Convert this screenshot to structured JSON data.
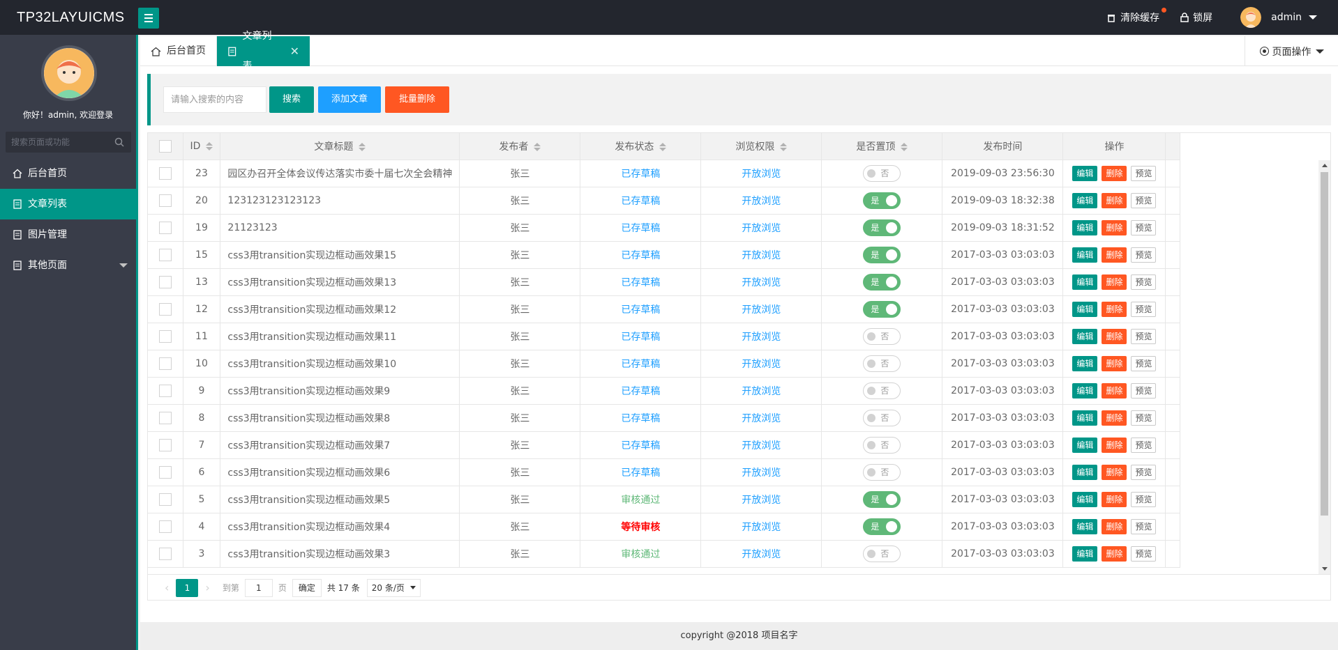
{
  "header": {
    "brand": "TP32LAYUICMS",
    "clear_cache": "清除缓存",
    "lock_screen": "锁屏",
    "user": "admin"
  },
  "sidebar": {
    "welcome": "你好！admin, 欢迎登录",
    "search_placeholder": "搜索页面或功能",
    "items": [
      {
        "label": "后台首页",
        "icon": "home-icon"
      },
      {
        "label": "文章列表",
        "icon": "article-icon",
        "active": true
      },
      {
        "label": "图片管理",
        "icon": "image-icon"
      },
      {
        "label": "其他页面",
        "icon": "page-icon",
        "expandable": true
      }
    ]
  },
  "tabs": {
    "home": "后台首页",
    "article": "文章列表",
    "page_ops": "页面操作"
  },
  "toolbar": {
    "search_placeholder": "请输入搜索的内容",
    "search_btn": "搜索",
    "add_btn": "添加文章",
    "batch_delete_btn": "批量删除"
  },
  "table": {
    "columns": [
      "ID",
      "文章标题",
      "发布者",
      "发布状态",
      "浏览权限",
      "是否置顶",
      "发布时间",
      "操作"
    ],
    "actions": {
      "edit": "编辑",
      "delete": "删除",
      "preview": "预览"
    },
    "switch": {
      "on": "是",
      "off": "否"
    },
    "rows": [
      {
        "id": "23",
        "title": "园区办召开全体会议传达落实市委十届七次全会精神",
        "author": "张三",
        "status": "已存草稿",
        "status_type": "draft",
        "perm": "开放浏览",
        "top": false,
        "time": "2019-09-03 23:56:30"
      },
      {
        "id": "20",
        "title": "123123123123123",
        "author": "张三",
        "status": "已存草稿",
        "status_type": "draft",
        "perm": "开放浏览",
        "top": true,
        "time": "2019-09-03 18:32:38"
      },
      {
        "id": "19",
        "title": "21123123",
        "author": "张三",
        "status": "已存草稿",
        "status_type": "draft",
        "perm": "开放浏览",
        "top": true,
        "time": "2019-09-03 18:31:52"
      },
      {
        "id": "15",
        "title": "css3用transition实现边框动画效果15",
        "author": "张三",
        "status": "已存草稿",
        "status_type": "draft",
        "perm": "开放浏览",
        "top": true,
        "time": "2017-03-03 03:03:03"
      },
      {
        "id": "13",
        "title": "css3用transition实现边框动画效果13",
        "author": "张三",
        "status": "已存草稿",
        "status_type": "draft",
        "perm": "开放浏览",
        "top": true,
        "time": "2017-03-03 03:03:03"
      },
      {
        "id": "12",
        "title": "css3用transition实现边框动画效果12",
        "author": "张三",
        "status": "已存草稿",
        "status_type": "draft",
        "perm": "开放浏览",
        "top": true,
        "time": "2017-03-03 03:03:03"
      },
      {
        "id": "11",
        "title": "css3用transition实现边框动画效果11",
        "author": "张三",
        "status": "已存草稿",
        "status_type": "draft",
        "perm": "开放浏览",
        "top": false,
        "time": "2017-03-03 03:03:03"
      },
      {
        "id": "10",
        "title": "css3用transition实现边框动画效果10",
        "author": "张三",
        "status": "已存草稿",
        "status_type": "draft",
        "perm": "开放浏览",
        "top": false,
        "time": "2017-03-03 03:03:03"
      },
      {
        "id": "9",
        "title": "css3用transition实现边框动画效果9",
        "author": "张三",
        "status": "已存草稿",
        "status_type": "draft",
        "perm": "开放浏览",
        "top": false,
        "time": "2017-03-03 03:03:03"
      },
      {
        "id": "8",
        "title": "css3用transition实现边框动画效果8",
        "author": "张三",
        "status": "已存草稿",
        "status_type": "draft",
        "perm": "开放浏览",
        "top": false,
        "time": "2017-03-03 03:03:03"
      },
      {
        "id": "7",
        "title": "css3用transition实现边框动画效果7",
        "author": "张三",
        "status": "已存草稿",
        "status_type": "draft",
        "perm": "开放浏览",
        "top": false,
        "time": "2017-03-03 03:03:03"
      },
      {
        "id": "6",
        "title": "css3用transition实现边框动画效果6",
        "author": "张三",
        "status": "已存草稿",
        "status_type": "draft",
        "perm": "开放浏览",
        "top": false,
        "time": "2017-03-03 03:03:03"
      },
      {
        "id": "5",
        "title": "css3用transition实现边框动画效果5",
        "author": "张三",
        "status": "审核通过",
        "status_type": "pass",
        "perm": "开放浏览",
        "top": true,
        "time": "2017-03-03 03:03:03"
      },
      {
        "id": "4",
        "title": "css3用transition实现边框动画效果4",
        "author": "张三",
        "status": "等待审核",
        "status_type": "wait",
        "perm": "开放浏览",
        "top": true,
        "time": "2017-03-03 03:03:03"
      },
      {
        "id": "3",
        "title": "css3用transition实现边框动画效果3",
        "author": "张三",
        "status": "审核通过",
        "status_type": "pass",
        "perm": "开放浏览",
        "top": false,
        "time": "2017-03-03 03:03:03"
      }
    ]
  },
  "pager": {
    "current": "1",
    "goto_label": "到第",
    "goto_value": "1",
    "page_label": "页",
    "confirm": "确定",
    "total": "共 17 条",
    "per_page": "20 条/页"
  },
  "footer": "copyright @2018 项目名字",
  "colors": {
    "accent": "#009688",
    "blue": "#1e9fff",
    "danger": "#ff5722",
    "header_bg": "#23262e",
    "sidebar_bg": "#393d49"
  }
}
